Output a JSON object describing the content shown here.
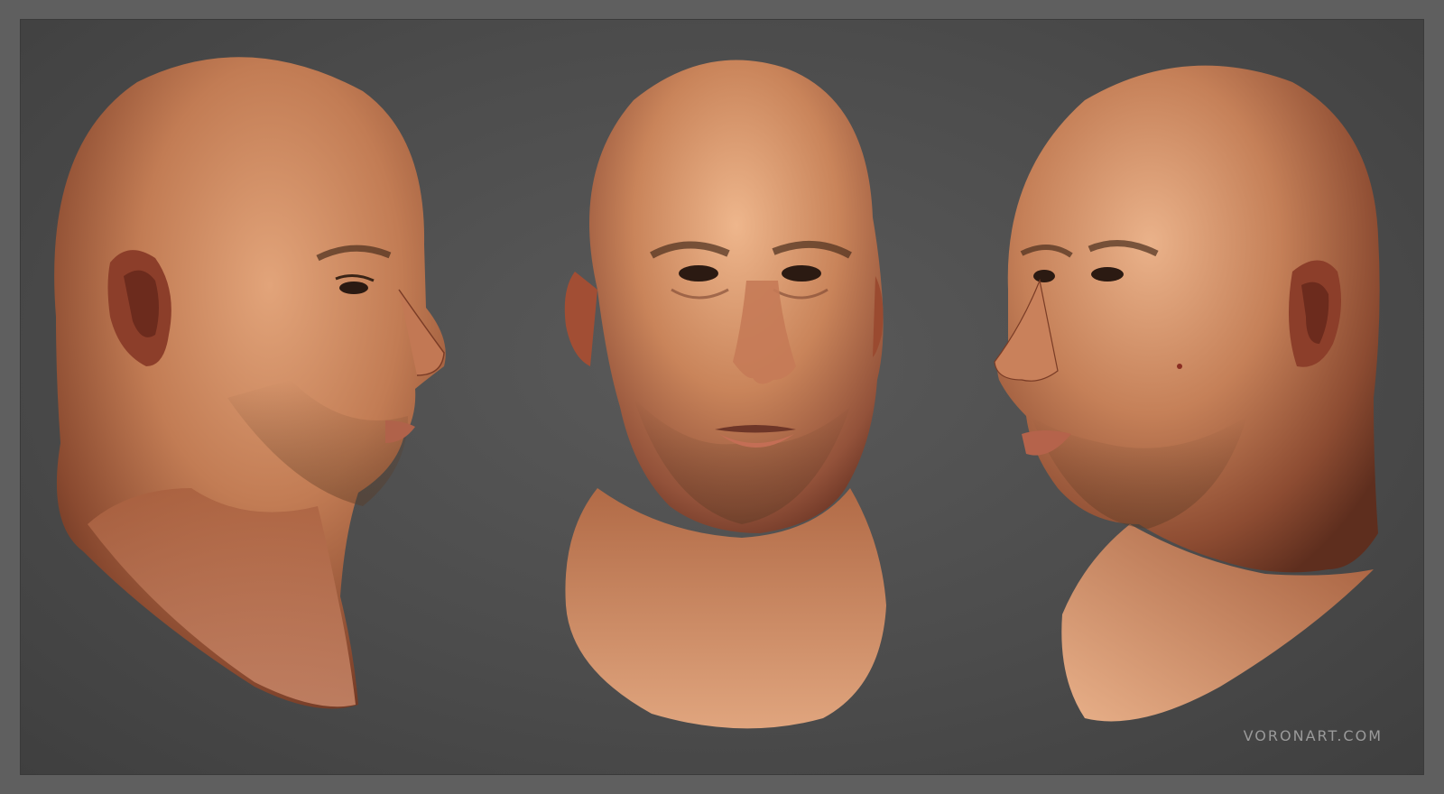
{
  "scene": {
    "background_color": "#4a4a4a",
    "frame_color": "#5f5f5f",
    "skin_base_color": "#c9835a",
    "skin_shadow_color": "#6b3622",
    "skin_highlight_color": "#eab28a",
    "watermark": "VORONART.COM",
    "views": [
      {
        "name": "right-profile-view"
      },
      {
        "name": "front-view"
      },
      {
        "name": "left-three-quarter-view"
      }
    ]
  }
}
